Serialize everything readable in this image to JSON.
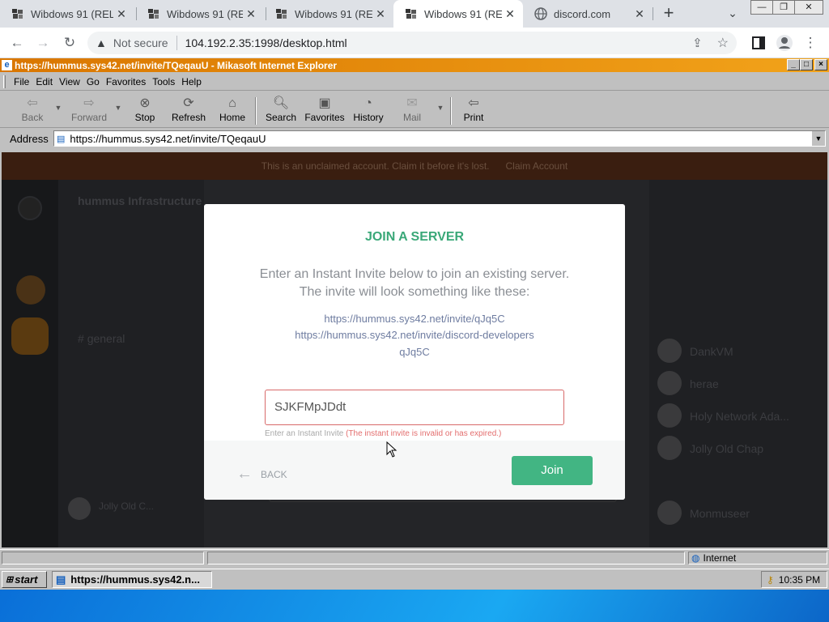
{
  "browser": {
    "tabs": [
      {
        "title": "Wibdows 91 (REL",
        "active": false
      },
      {
        "title": "Wibdows 91 (REL",
        "active": false
      },
      {
        "title": "Wibdows 91 (REL",
        "active": false
      },
      {
        "title": "Wibdows 91 (REL",
        "active": true
      },
      {
        "title": "discord.com",
        "active": false
      }
    ],
    "security_label": "Not secure",
    "url": "104.192.2.35:1998/desktop.html"
  },
  "ie": {
    "title": "https://hummus.sys42.net/invite/TQeqauU - Mikasoft Internet Explorer",
    "menu": [
      "File",
      "Edit",
      "View",
      "Go",
      "Favorites",
      "Tools",
      "Help"
    ],
    "toolbar": {
      "back": "Back",
      "forward": "Forward",
      "stop": "Stop",
      "refresh": "Refresh",
      "home": "Home",
      "search": "Search",
      "favorites": "Favorites",
      "history": "History",
      "mail": "Mail",
      "print": "Print"
    },
    "address_label": "Address",
    "address_value": "https://hummus.sys42.net/invite/TQeqauU",
    "status_zone": "Internet"
  },
  "app": {
    "banner": "This is an unclaimed account. Claim it before it's lost.",
    "banner_action": "Claim Account",
    "server_name": "hummus Infrastructure",
    "channel": "general",
    "self_user": "Jolly Old C...",
    "members": [
      "DankVM",
      "herae",
      "Holy Network Ada...",
      "Jolly Old Chap",
      "Monmuseer"
    ]
  },
  "modal": {
    "title": "JOIN A SERVER",
    "description": "Enter an Instant Invite below to join an existing server. The invite will look something like these:",
    "examples": [
      "https://hummus.sys42.net/invite/qJq5C",
      "https://hummus.sys42.net/invite/discord-developers",
      "qJq5C"
    ],
    "input_value": "SJKFMpJDdt",
    "input_label": "Enter an Instant Invite",
    "error": "(The instant invite is invalid or has expired.)",
    "back_label": "BACK",
    "join_label": "Join"
  },
  "taskbar": {
    "start": "start",
    "task": "https://hummus.sys42.n...",
    "clock": "10:35 PM"
  },
  "colors": {
    "accent_green": "#42b583",
    "title_green": "#3aa878",
    "error_red": "#e36e6e",
    "ie_title": "#e08a10"
  }
}
